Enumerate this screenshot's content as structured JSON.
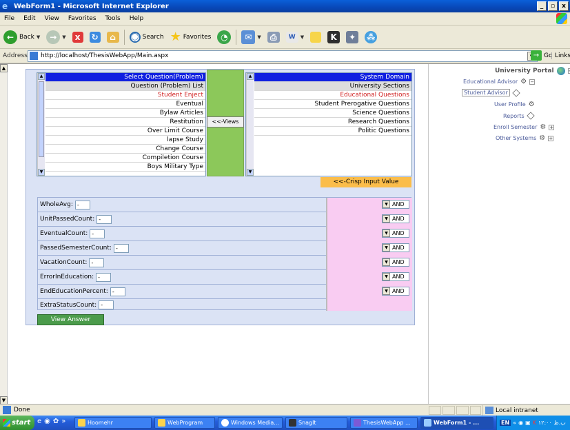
{
  "window": {
    "title": "WebForm1 - Microsoft Internet Explorer"
  },
  "menu": [
    "File",
    "Edit",
    "View",
    "Favorites",
    "Tools",
    "Help"
  ],
  "toolbar": {
    "back": "Back",
    "search": "Search",
    "favorites": "Favorites"
  },
  "address": {
    "label": "Address",
    "url": "http://localhost/ThesisWebApp/Main.aspx",
    "go": "Go",
    "links": "Links"
  },
  "questions": {
    "header": "Select Question(Problem)",
    "subheader": "Question (Problem) List",
    "items": [
      "Student Enject",
      "Eventual",
      "Bylaw Articles",
      "Restitution",
      "Over Limit Course",
      "lapse Study",
      "Change Course",
      "Compiletion Course",
      "Boys Military Type"
    ]
  },
  "views_button": "<<-Views",
  "domains": {
    "header": "System Domain",
    "subheader": "University Sections",
    "items": [
      "Educational Questions",
      "Student Prerogative Questions",
      "Science Questions",
      "Research Questions",
      "Politic Questions"
    ]
  },
  "crisp_button": "<<-Crisp Input Value",
  "params": [
    {
      "name": "WholeAvg:",
      "value": "-",
      "op": "AND"
    },
    {
      "name": "UnitPassedCount:",
      "value": "-",
      "op": "AND"
    },
    {
      "name": "EventualCount:",
      "value": "-",
      "op": "AND"
    },
    {
      "name": "PassedSemesterCount:",
      "value": "-",
      "op": "AND"
    },
    {
      "name": "VacationCount:",
      "value": "-",
      "op": "AND"
    },
    {
      "name": "ErrorInEducation:",
      "value": "-",
      "op": "AND"
    },
    {
      "name": "EndEducationPercent:",
      "value": "-",
      "op": "AND"
    },
    {
      "name": "ExtraStatusCount:",
      "value": "-",
      "op": ""
    }
  ],
  "answer_button": "View Answer",
  "tree": {
    "title": "University Portal",
    "nodes": [
      "Educational Advisor",
      "Student Advisor",
      "User Profile",
      "Reports",
      "Enroll Semester",
      "Other Systems"
    ]
  },
  "status": {
    "text": "Done",
    "zone": "Local intranet"
  },
  "taskbar": {
    "start": "start",
    "tasks": [
      "Hoomehr",
      "WebProgram",
      "Windows Media...",
      "SnagIt",
      "ThesisWebApp ...",
      "WebForm1 - ..."
    ],
    "lang": "EN",
    "clock": "۱۲:۰۰ ب.ظ"
  }
}
